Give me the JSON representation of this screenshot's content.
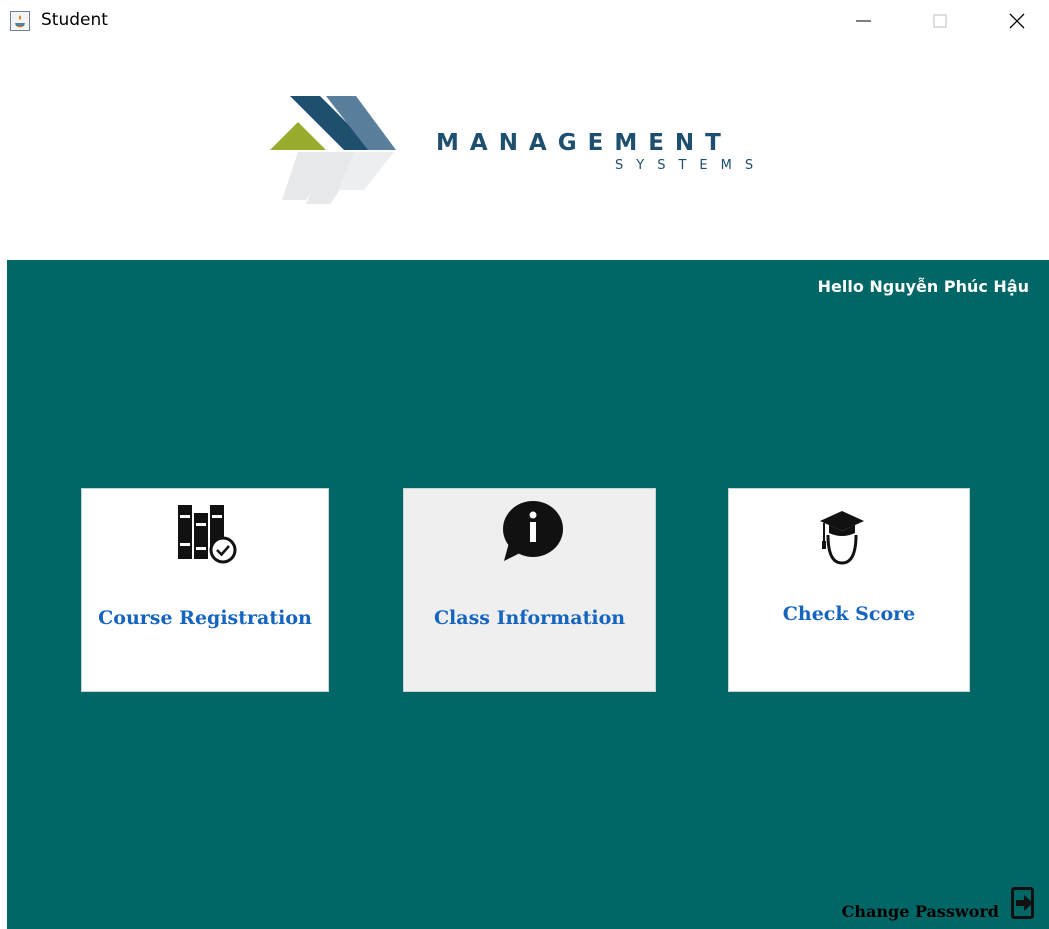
{
  "window": {
    "title": "Student",
    "controls": [
      "minimize",
      "maximize",
      "close"
    ]
  },
  "branding": {
    "name": "MANAGEMENT",
    "subtitle": "SYSTEMS",
    "colors": {
      "dark_blue": "#1e4f6e",
      "steel_blue": "#5a7f9c",
      "olive": "#9aab2e",
      "light_gray": "#e3e6e8"
    }
  },
  "panel": {
    "background": "#006666",
    "greeting": "Hello Nguyễn Phúc Hậu"
  },
  "cards": [
    {
      "label": "Course Registration",
      "icon": "books-check-icon"
    },
    {
      "label": "Class Information",
      "icon": "info-speech-bubble-icon"
    },
    {
      "label": "Check Score",
      "icon": "graduate-cap-icon"
    }
  ],
  "footer": {
    "change_password": "Change Password",
    "icon": "logout-icon"
  }
}
